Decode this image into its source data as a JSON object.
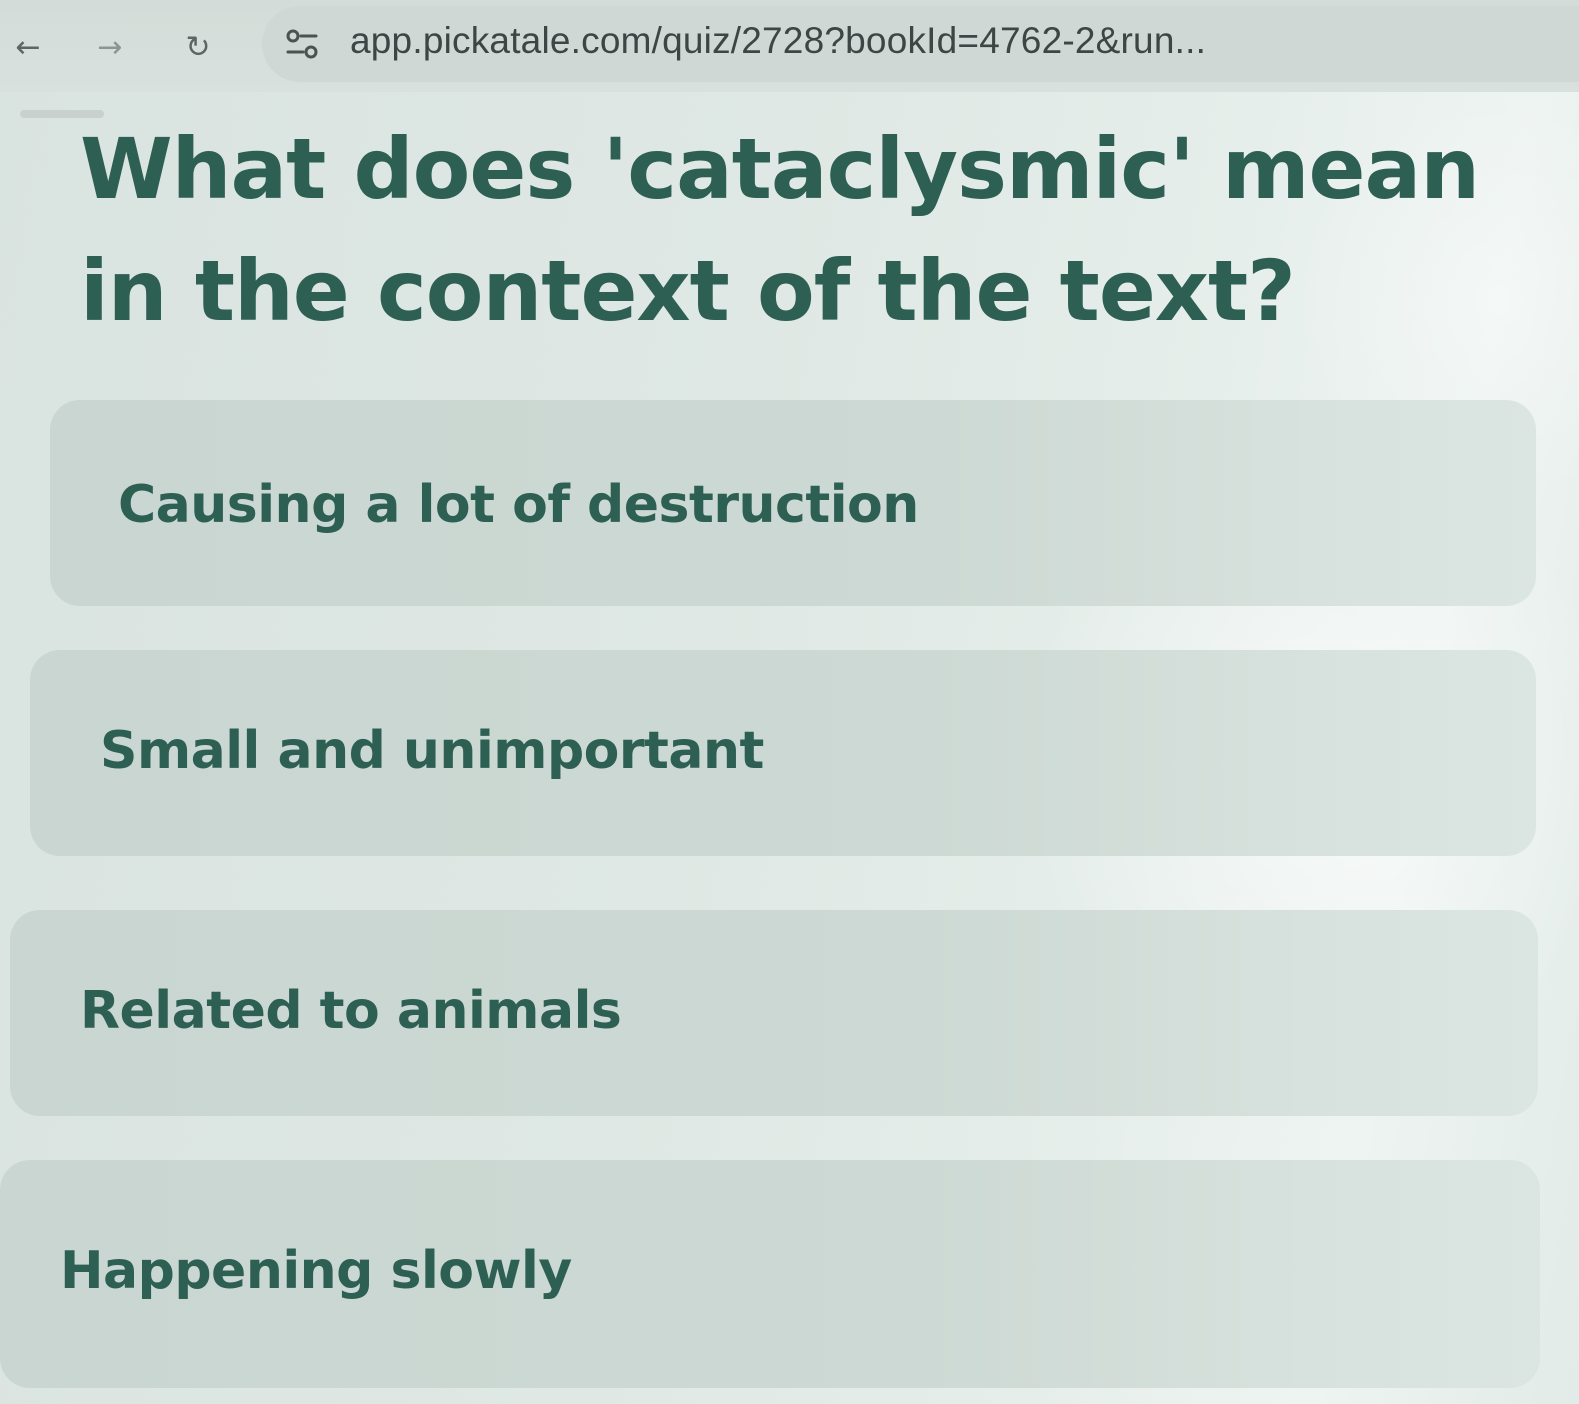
{
  "browser": {
    "url": "app.pickatale.com/quiz/2728?bookId=4762-2&run..."
  },
  "icons": {
    "back": "arrow-left-icon",
    "forward": "arrow-right-icon",
    "reload": "reload-icon",
    "site_info": "site-settings-icon"
  },
  "quiz": {
    "question": "What does 'cataclysmic' mean in the context of the text?",
    "options": [
      {
        "label": "Causing a lot of destruction"
      },
      {
        "label": "Small and unimportant"
      },
      {
        "label": "Related to animals"
      },
      {
        "label": "Happening slowly"
      }
    ]
  },
  "colors": {
    "text_primary": "#2e5f53",
    "option_background": "#cdd9d4",
    "page_background": "#dfe8e4"
  }
}
